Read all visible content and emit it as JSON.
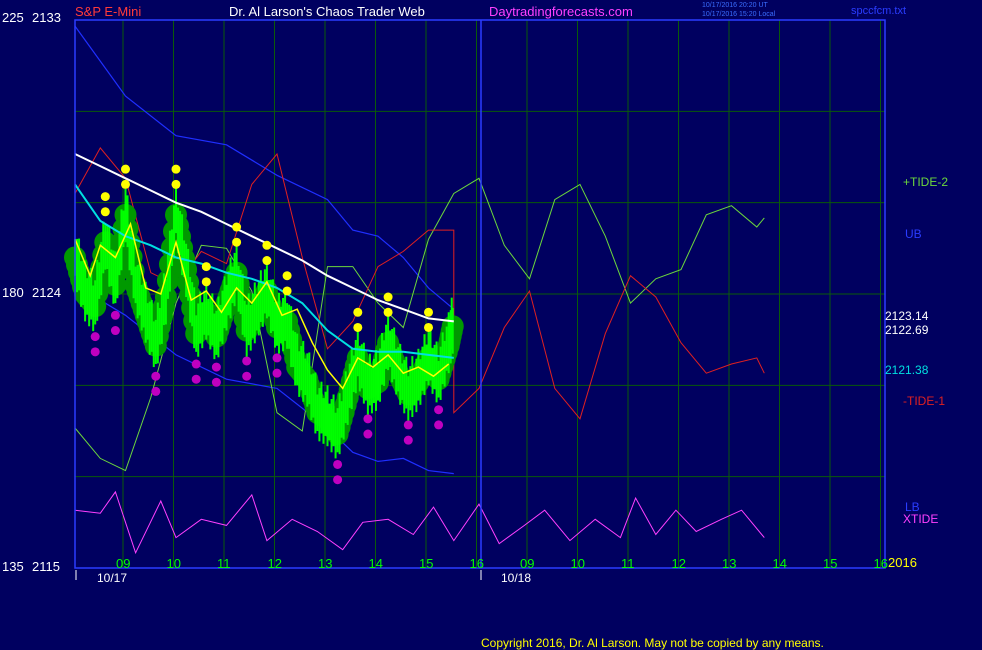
{
  "header": {
    "scale_top_left": "225",
    "price_top": "2133",
    "symbol": "S&P E-Mini",
    "title": "Dr. Al Larson's Chaos Trader Web",
    "site": "Daytradingforecasts.com",
    "timestamp_ut": "10/17/2016 20:20 UT",
    "timestamp_local": "10/17/2016 15:20 Local",
    "file": "spccfcm.txt"
  },
  "footer": {
    "copyright": "Copyright 2016, Dr. Al Larson. May not be copied by any means."
  },
  "colors": {
    "background": "#000060",
    "grid": "#0a5a0a",
    "frame": "#2a3cff",
    "price_bars": "#00ff00",
    "ma_fast": "#ffff00",
    "ma_slow": "#00e0e0",
    "ma_long": "#ffffff",
    "band": "#1f2fff",
    "tide2": "#6cd83c",
    "tide1": "#e02020",
    "xtide": "#ff40ff",
    "highs": "#ffff00",
    "lows": "#c000c0",
    "halo": "#009900"
  },
  "chart_data": {
    "type": "line",
    "instrument": "S&P E-Mini",
    "y_left_top": "225",
    "y_left_mid": "180",
    "y_left_bottom": "135",
    "y_price_top": "2133",
    "y_price_mid": "2124",
    "y_price_bottom": "2115",
    "ylim": [
      2115,
      2133
    ],
    "x_hour_labels": [
      "09",
      "10",
      "11",
      "12",
      "13",
      "14",
      "15",
      "16",
      "09",
      "10",
      "11",
      "12",
      "13",
      "14",
      "15",
      "16"
    ],
    "date_labels": [
      "10/17",
      "10/18"
    ],
    "year_label": "2016",
    "value_labels": {
      "a": "2123.14",
      "b": "2122.69",
      "c": "2121.38"
    },
    "legend": {
      "tide2": "+TIDE-2",
      "ub": "UB",
      "tide1": "-TIDE-1",
      "lb": "LB",
      "xtide": "XTIDE"
    },
    "ma_long": [
      [
        8.5,
        2128.6
      ],
      [
        9,
        2128.2
      ],
      [
        9.5,
        2127.8
      ],
      [
        10,
        2127.4
      ],
      [
        10.5,
        2127.0
      ],
      [
        11,
        2126.7
      ],
      [
        11.5,
        2126.3
      ],
      [
        12,
        2125.9
      ],
      [
        12.5,
        2125.5
      ],
      [
        13,
        2125.1
      ],
      [
        13.5,
        2124.6
      ],
      [
        14,
        2124.2
      ],
      [
        14.5,
        2123.8
      ],
      [
        15,
        2123.5
      ],
      [
        15.5,
        2123.2
      ],
      [
        16,
        2123.1
      ]
    ],
    "ma_slow": [
      [
        8.5,
        2127.6
      ],
      [
        9,
        2126.4
      ],
      [
        9.5,
        2125.9
      ],
      [
        10,
        2125.6
      ],
      [
        10.5,
        2125.2
      ],
      [
        11,
        2125.0
      ],
      [
        11.5,
        2124.7
      ],
      [
        12,
        2124.5
      ],
      [
        12.5,
        2124.2
      ],
      [
        13,
        2123.7
      ],
      [
        13.5,
        2122.8
      ],
      [
        14,
        2122.2
      ],
      [
        14.5,
        2122.1
      ],
      [
        15,
        2122.1
      ],
      [
        15.5,
        2122.0
      ],
      [
        16,
        2121.9
      ]
    ],
    "ma_fast": [
      [
        8.5,
        2125.8
      ],
      [
        8.8,
        2124.6
      ],
      [
        9.0,
        2125.6
      ],
      [
        9.3,
        2125.2
      ],
      [
        9.6,
        2126.3
      ],
      [
        9.9,
        2124.2
      ],
      [
        10.2,
        2124.0
      ],
      [
        10.5,
        2125.7
      ],
      [
        10.8,
        2123.8
      ],
      [
        11.1,
        2124.1
      ],
      [
        11.4,
        2123.4
      ],
      [
        11.7,
        2124.2
      ],
      [
        12.0,
        2123.7
      ],
      [
        12.3,
        2124.4
      ],
      [
        12.6,
        2123.3
      ],
      [
        12.9,
        2123.5
      ],
      [
        13.2,
        2122.4
      ],
      [
        13.5,
        2121.5
      ],
      [
        13.8,
        2120.9
      ],
      [
        14.1,
        2121.9
      ],
      [
        14.4,
        2121.6
      ],
      [
        14.7,
        2122.0
      ],
      [
        15.0,
        2121.4
      ],
      [
        15.3,
        2121.6
      ],
      [
        15.6,
        2121.3
      ],
      [
        15.9,
        2121.7
      ]
    ],
    "upper_band": [
      [
        8.5,
        2132.8
      ],
      [
        9.5,
        2130.5
      ],
      [
        10.5,
        2129.2
      ],
      [
        11.5,
        2128.9
      ],
      [
        12.5,
        2127.9
      ],
      [
        13.5,
        2127.1
      ],
      [
        14,
        2126.1
      ],
      [
        14.5,
        2125.9
      ],
      [
        15,
        2125.2
      ],
      [
        15.5,
        2124.2
      ],
      [
        16,
        2123.5
      ]
    ],
    "lower_band": [
      [
        8.5,
        2124.3
      ],
      [
        9.5,
        2123.3
      ],
      [
        10.5,
        2122.0
      ],
      [
        11.5,
        2121.2
      ],
      [
        12.5,
        2120.9
      ],
      [
        13.5,
        2119.6
      ],
      [
        14,
        2118.8
      ],
      [
        14.5,
        2118.5
      ],
      [
        15,
        2118.6
      ],
      [
        15.5,
        2118.2
      ],
      [
        16,
        2118.1
      ]
    ],
    "tide2": [
      [
        8.5,
        2119.6
      ],
      [
        9,
        2118.6
      ],
      [
        9.5,
        2118.2
      ],
      [
        10,
        2120.6
      ],
      [
        10.5,
        2123.7
      ],
      [
        11,
        2125.6
      ],
      [
        11.5,
        2125.5
      ],
      [
        12,
        2124.1
      ],
      [
        12.5,
        2120.1
      ],
      [
        13,
        2119.5
      ],
      [
        13.5,
        2124.9
      ],
      [
        14,
        2124.9
      ],
      [
        14.5,
        2123.7
      ],
      [
        15,
        2122.9
      ],
      [
        15.5,
        2125.8
      ],
      [
        16,
        2127.3
      ],
      [
        16.5,
        2127.8
      ],
      [
        17,
        2125.6
      ],
      [
        17.5,
        2124.5
      ],
      [
        18,
        2127.1
      ],
      [
        18.5,
        2127.6
      ],
      [
        19,
        2125.9
      ],
      [
        19.5,
        2123.7
      ],
      [
        20,
        2124.5
      ],
      [
        20.5,
        2124.8
      ],
      [
        21,
        2126.6
      ],
      [
        21.5,
        2126.9
      ],
      [
        22,
        2126.2
      ],
      [
        22.15,
        2126.5
      ]
    ],
    "tide1": [
      [
        8.5,
        2127.3
      ],
      [
        9,
        2128.8
      ],
      [
        9.5,
        2127.8
      ],
      [
        10,
        2124.7
      ],
      [
        10.5,
        2124.3
      ],
      [
        11,
        2125.4
      ],
      [
        11.5,
        2125.0
      ],
      [
        12,
        2127.6
      ],
      [
        12.5,
        2128.6
      ],
      [
        13,
        2125.2
      ],
      [
        13.5,
        2122.2
      ],
      [
        14,
        2123.1
      ],
      [
        14.5,
        2124.9
      ],
      [
        15,
        2125.4
      ],
      [
        15.5,
        2126.1
      ],
      [
        16,
        2126.1
      ],
      [
        16,
        2120.1
      ],
      [
        16.5,
        2120.9
      ],
      [
        17,
        2122.9
      ],
      [
        17.5,
        2124.1
      ],
      [
        18,
        2120.9
      ],
      [
        18.5,
        2119.9
      ],
      [
        19,
        2122.7
      ],
      [
        19.5,
        2124.6
      ],
      [
        20,
        2123.9
      ],
      [
        20.5,
        2122.4
      ],
      [
        21,
        2121.4
      ],
      [
        21.5,
        2121.7
      ],
      [
        22,
        2121.9
      ],
      [
        22.15,
        2121.4
      ]
    ],
    "xtide": [
      [
        8.5,
        2116.9
      ],
      [
        9,
        2116.8
      ],
      [
        9.3,
        2117.5
      ],
      [
        9.7,
        2115.5
      ],
      [
        10.2,
        2117.2
      ],
      [
        10.5,
        2116.0
      ],
      [
        11,
        2116.6
      ],
      [
        11.5,
        2116.4
      ],
      [
        12,
        2117.4
      ],
      [
        12.3,
        2115.9
      ],
      [
        12.8,
        2116.6
      ],
      [
        13.3,
        2116.2
      ],
      [
        13.8,
        2115.6
      ],
      [
        14.2,
        2116.5
      ],
      [
        14.7,
        2116.6
      ],
      [
        15.2,
        2116.1
      ],
      [
        15.6,
        2117.0
      ],
      [
        16,
        2115.9
      ],
      [
        16.5,
        2117.1
      ],
      [
        16.9,
        2115.8
      ],
      [
        17.4,
        2116.4
      ],
      [
        17.8,
        2116.9
      ],
      [
        18.3,
        2115.9
      ],
      [
        18.8,
        2116.6
      ],
      [
        19.3,
        2116.0
      ],
      [
        19.6,
        2117.3
      ],
      [
        20,
        2116.1
      ],
      [
        20.4,
        2116.9
      ],
      [
        20.8,
        2116.2
      ],
      [
        21.3,
        2116.6
      ],
      [
        21.7,
        2116.9
      ],
      [
        22.15,
        2116.0
      ]
    ],
    "price_path": [
      [
        8.5,
        2125.2
      ],
      [
        8.7,
        2124.0
      ],
      [
        8.9,
        2123.6
      ],
      [
        9.1,
        2125.7
      ],
      [
        9.3,
        2124.3
      ],
      [
        9.5,
        2126.6
      ],
      [
        9.7,
        2124.3
      ],
      [
        9.9,
        2123.3
      ],
      [
        10.1,
        2122.3
      ],
      [
        10.3,
        2123.9
      ],
      [
        10.5,
        2126.6
      ],
      [
        10.7,
        2124.8
      ],
      [
        10.9,
        2122.7
      ],
      [
        11.1,
        2123.4
      ],
      [
        11.3,
        2122.6
      ],
      [
        11.5,
        2123.7
      ],
      [
        11.7,
        2124.7
      ],
      [
        11.9,
        2122.8
      ],
      [
        12.1,
        2123.4
      ],
      [
        12.3,
        2124.1
      ],
      [
        12.5,
        2122.9
      ],
      [
        12.7,
        2123.1
      ],
      [
        12.9,
        2121.6
      ],
      [
        13.1,
        2121.2
      ],
      [
        13.3,
        2120.1
      ],
      [
        13.5,
        2119.9
      ],
      [
        13.7,
        2119.4
      ],
      [
        13.9,
        2120.6
      ],
      [
        14.1,
        2121.9
      ],
      [
        14.3,
        2120.9
      ],
      [
        14.5,
        2121.1
      ],
      [
        14.7,
        2122.4
      ],
      [
        14.9,
        2121.4
      ],
      [
        15.1,
        2120.7
      ],
      [
        15.3,
        2121.1
      ],
      [
        15.5,
        2121.9
      ],
      [
        15.7,
        2121.2
      ],
      [
        15.9,
        2122.3
      ],
      [
        16.0,
        2123.1
      ]
    ]
  }
}
